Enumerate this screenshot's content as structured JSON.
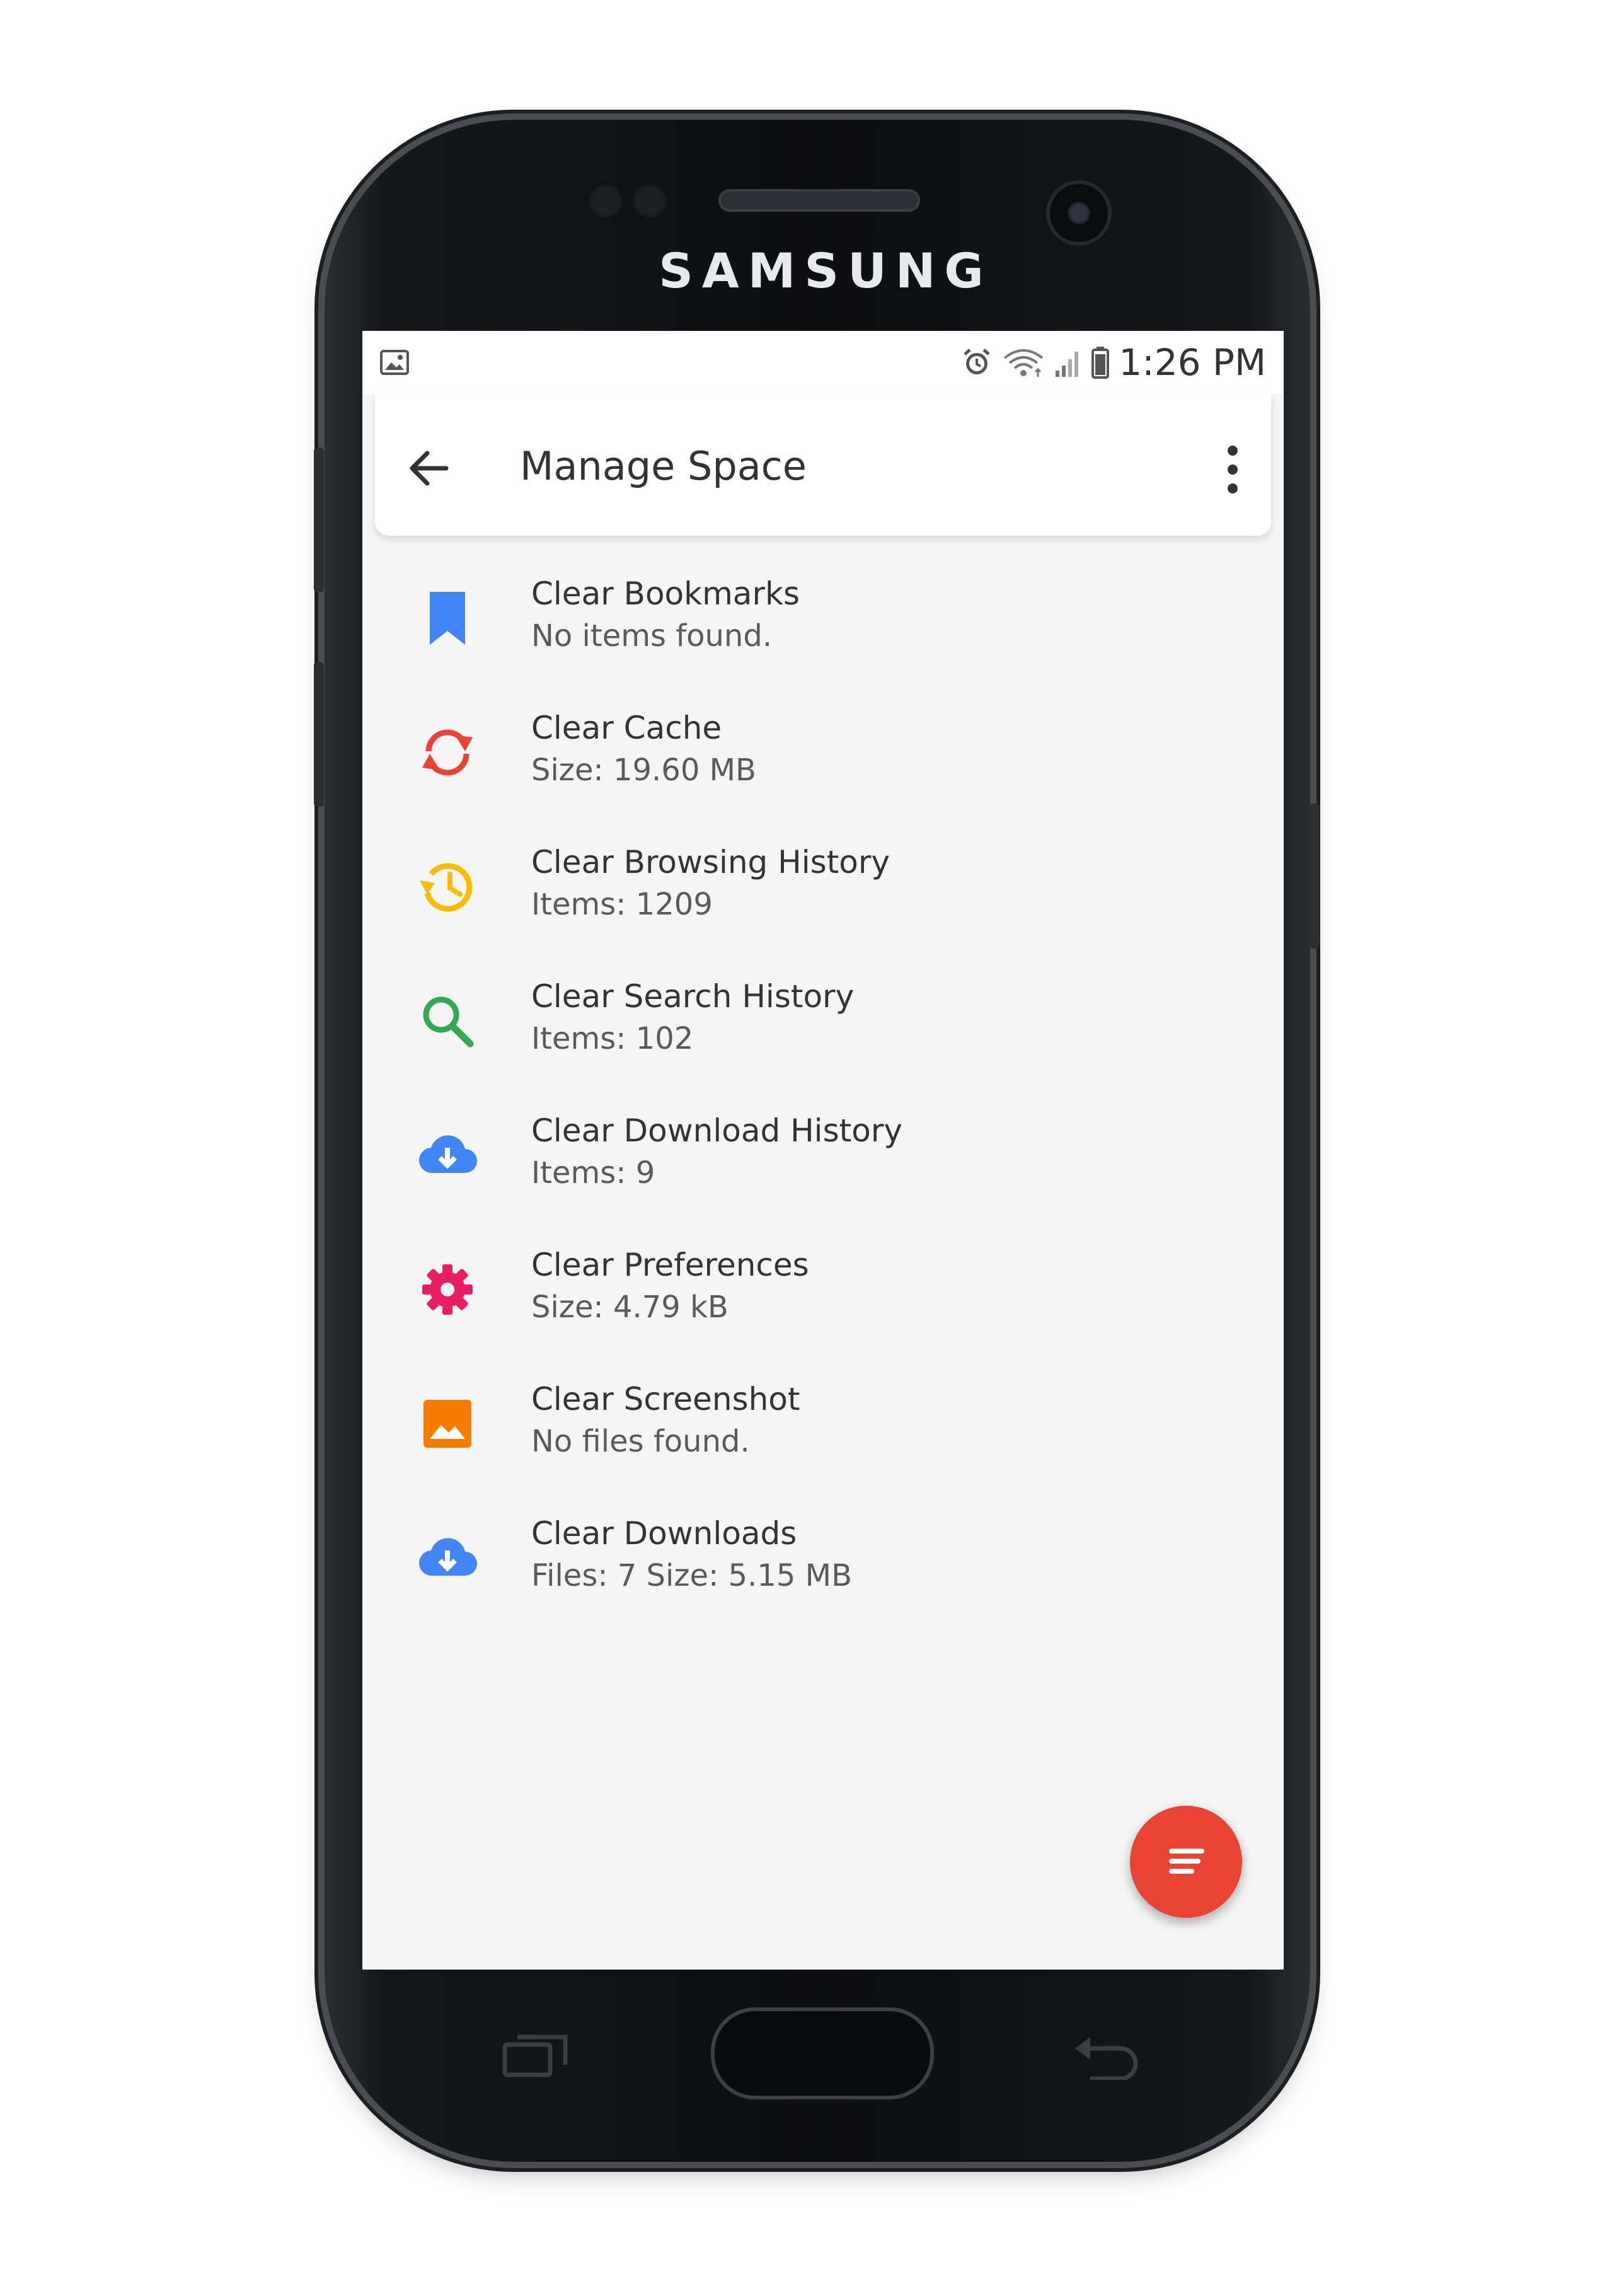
{
  "device": {
    "brand": "SAMSUNG"
  },
  "status_bar": {
    "time": "1:26 PM",
    "icons": [
      "gallery-icon",
      "alarm-icon",
      "wifi-icon",
      "signal-icon",
      "battery-icon"
    ]
  },
  "app_bar": {
    "title": "Manage Space",
    "back_icon": "arrow-back-icon",
    "menu_icon": "more-vert-icon"
  },
  "items": [
    {
      "title": "Clear Bookmarks",
      "subtitle": "No items found.",
      "icon": "bookmark-icon",
      "color": "#4285f4"
    },
    {
      "title": "Clear Cache",
      "subtitle": "Size: 19.60 MB",
      "icon": "sync-icon",
      "color": "#ea4335"
    },
    {
      "title": "Clear Browsing History",
      "subtitle": "Items: 1209",
      "icon": "history-icon",
      "color": "#fbbc05"
    },
    {
      "title": "Clear Search History",
      "subtitle": "Items: 102",
      "icon": "search-icon",
      "color": "#34a853"
    },
    {
      "title": "Clear Download History",
      "subtitle": "Items: 9",
      "icon": "cloud-download-icon",
      "color": "#4285f4"
    },
    {
      "title": "Clear Preferences",
      "subtitle": "Size: 4.79 kB",
      "icon": "settings-icon",
      "color": "#e91e63"
    },
    {
      "title": "Clear Screenshot",
      "subtitle": "No files found.",
      "icon": "image-icon",
      "color": "#f57c00"
    },
    {
      "title": "Clear Downloads",
      "subtitle": "Files: 7 Size: 5.15 MB",
      "icon": "cloud-download-icon",
      "color": "#4285f4"
    }
  ],
  "fab": {
    "icon": "sort-icon",
    "color": "#ea4335"
  }
}
